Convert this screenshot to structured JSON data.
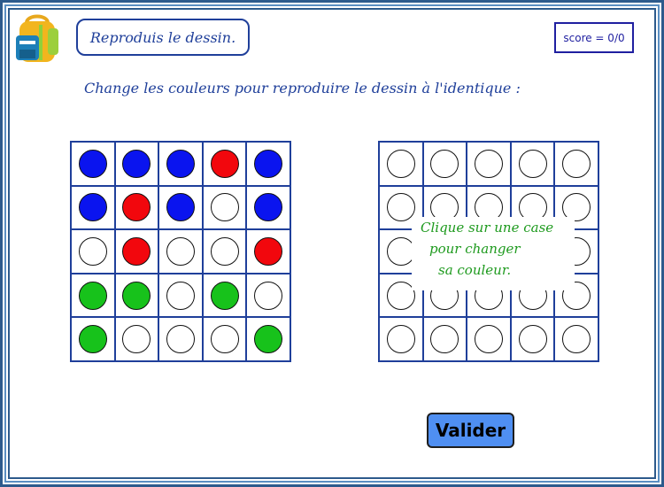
{
  "header": {
    "title": "Reproduis le dessin.",
    "score": "score = 0/0",
    "logo_icon": "backpack-icon"
  },
  "instruction": "Change les couleurs pour reproduire le dessin à l'identique :",
  "colors": {
    "blue": "#0a14ef",
    "red": "#f2070d",
    "green": "#17c21b",
    "white": "#ffffff",
    "grid_line": "#1f3f9a",
    "button": "#4f8ff2"
  },
  "model_grid": [
    [
      "blue",
      "blue",
      "blue",
      "red",
      "blue"
    ],
    [
      "blue",
      "red",
      "blue",
      "white",
      "blue"
    ],
    [
      "white",
      "red",
      "white",
      "white",
      "red"
    ],
    [
      "green",
      "green",
      "white",
      "green",
      "white"
    ],
    [
      "green",
      "white",
      "white",
      "white",
      "green"
    ]
  ],
  "answer_grid": [
    [
      "white",
      "white",
      "white",
      "white",
      "white"
    ],
    [
      "white",
      "white",
      "white",
      "white",
      "white"
    ],
    [
      "white",
      "white",
      "white",
      "white",
      "white"
    ],
    [
      "white",
      "white",
      "white",
      "white",
      "white"
    ],
    [
      "white",
      "white",
      "white",
      "white",
      "white"
    ]
  ],
  "tooltip": {
    "line1": "Clique sur une case",
    "line2": "pour changer",
    "line3": "sa couleur."
  },
  "actions": {
    "validate_label": "Valider"
  }
}
